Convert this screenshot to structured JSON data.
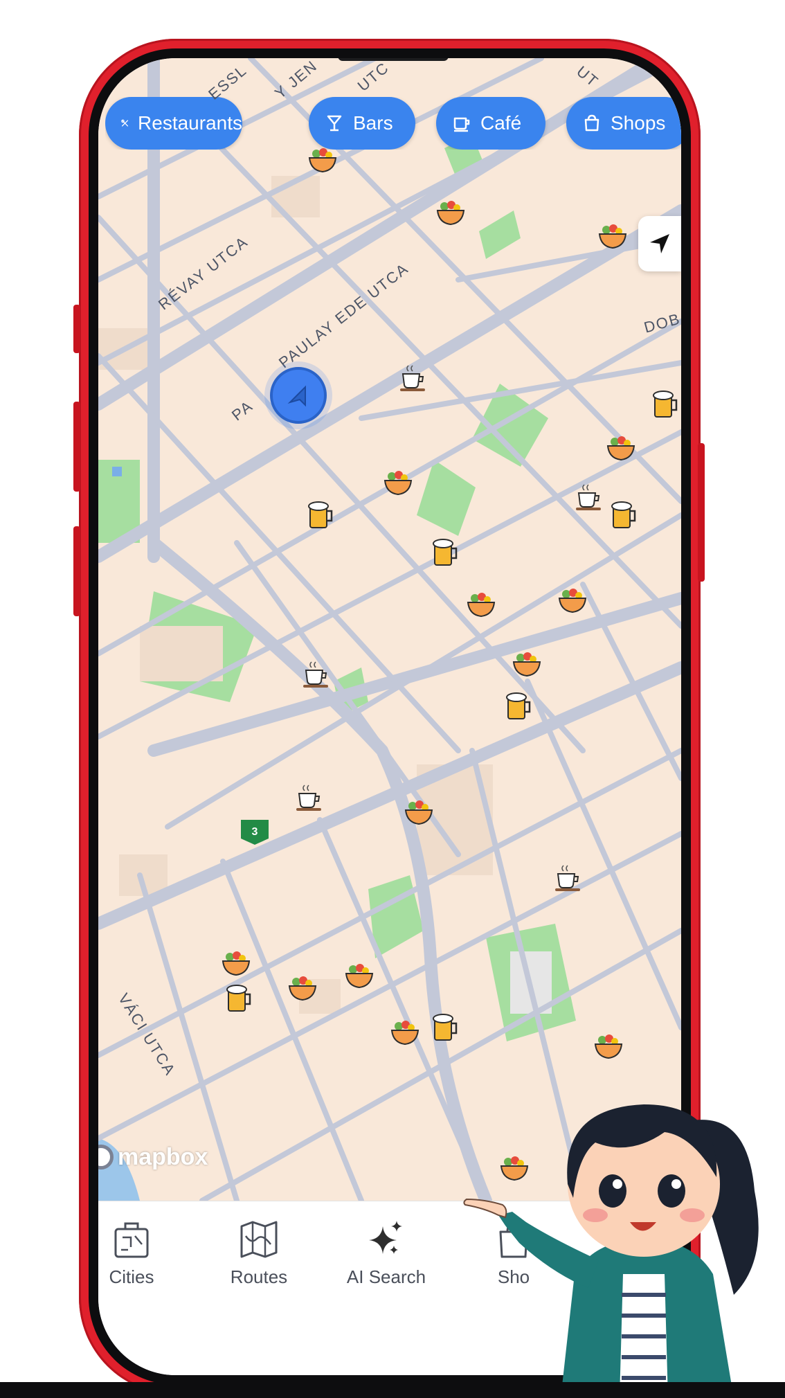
{
  "filters": [
    {
      "label": "Restaurants",
      "icon": "fork-knife-icon"
    },
    {
      "label": "Bars",
      "icon": "cocktail-glass-icon"
    },
    {
      "label": "Café",
      "icon": "coffee-cup-icon"
    },
    {
      "label": "Shops",
      "icon": "shopping-bag-icon"
    }
  ],
  "map": {
    "streets": {
      "revay": "RÉVAY UTCA",
      "paulay": "PAULAY EDE UTCA",
      "paulay_prefix": "PA",
      "vaci": "VÁCI UTCA",
      "dob": "DOB",
      "top1": "ESSL",
      "top2": "Y JEN",
      "top3": "UTC",
      "top4": "UT"
    },
    "route_shield": "3",
    "attribution": "mapbox",
    "colors": {
      "land": "#f9e8d9",
      "road": "#c3c8d8",
      "park": "#a6dea0",
      "water": "#9cc6ea",
      "accent": "#3a84ee"
    }
  },
  "tabs": [
    {
      "label": "Cities",
      "icon": "suitcase-icon"
    },
    {
      "label": "Routes",
      "icon": "folded-map-icon"
    },
    {
      "label": "AI Search",
      "icon": "sparkles-icon"
    },
    {
      "label": "Sho",
      "icon": "shopping-icon"
    }
  ]
}
